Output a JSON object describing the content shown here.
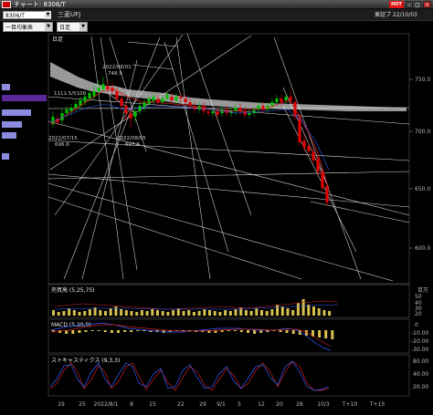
{
  "window": {
    "title": "チャート: 8306/T",
    "hot_badge": "HOT",
    "min_icon": "minimize-icon",
    "max_icon": "maximize-icon",
    "close_icon": "close-icon"
  },
  "toolbar": {
    "ticker_value": "8306/T",
    "stock_name": "三菱UFJ",
    "market_label": "東証プ 22/10/03"
  },
  "selectors": {
    "indicator": "一目均衡表",
    "period": "日足"
  },
  "chart": {
    "period_label": "日足",
    "price_ticks": [
      "750.0",
      "700.0",
      "650.0",
      "600.0"
    ],
    "annotations": {
      "high_date": "2022/08/01",
      "high_value": "748.9",
      "left_low_date": "2022/07/15",
      "left_low_value": "696.6",
      "mid_low_date": "2022/08/05",
      "mid_low_value": "697.8",
      "level_label": "1111.5/5100"
    },
    "volume_panel": {
      "label": "売買高 (5,25,75)",
      "unit_label": "百万",
      "ticks": [
        "50",
        "40",
        "30",
        "20",
        "10"
      ]
    },
    "macd_panel": {
      "label": "MACD (5,20,9)",
      "ticks": [
        "0",
        "-10.00",
        "-20.00",
        "-30.00"
      ]
    },
    "stoch_panel": {
      "label": "ストキャスティクス (9,3,3)",
      "ticks": [
        "80.00",
        "40.00",
        "20.00"
      ]
    },
    "x_ticks": [
      "19",
      "25",
      "2022/8/1",
      "8",
      "15",
      "22",
      "29",
      "9/1",
      "5",
      "12",
      "20",
      "26",
      "10/3",
      "T+10",
      "T+15"
    ],
    "colors": {
      "up_candle": "#00c000",
      "down_candle": "#e00000",
      "cloud": "#b0b0b0",
      "volume_bar": "#d8c050",
      "background": "#000000"
    }
  }
}
